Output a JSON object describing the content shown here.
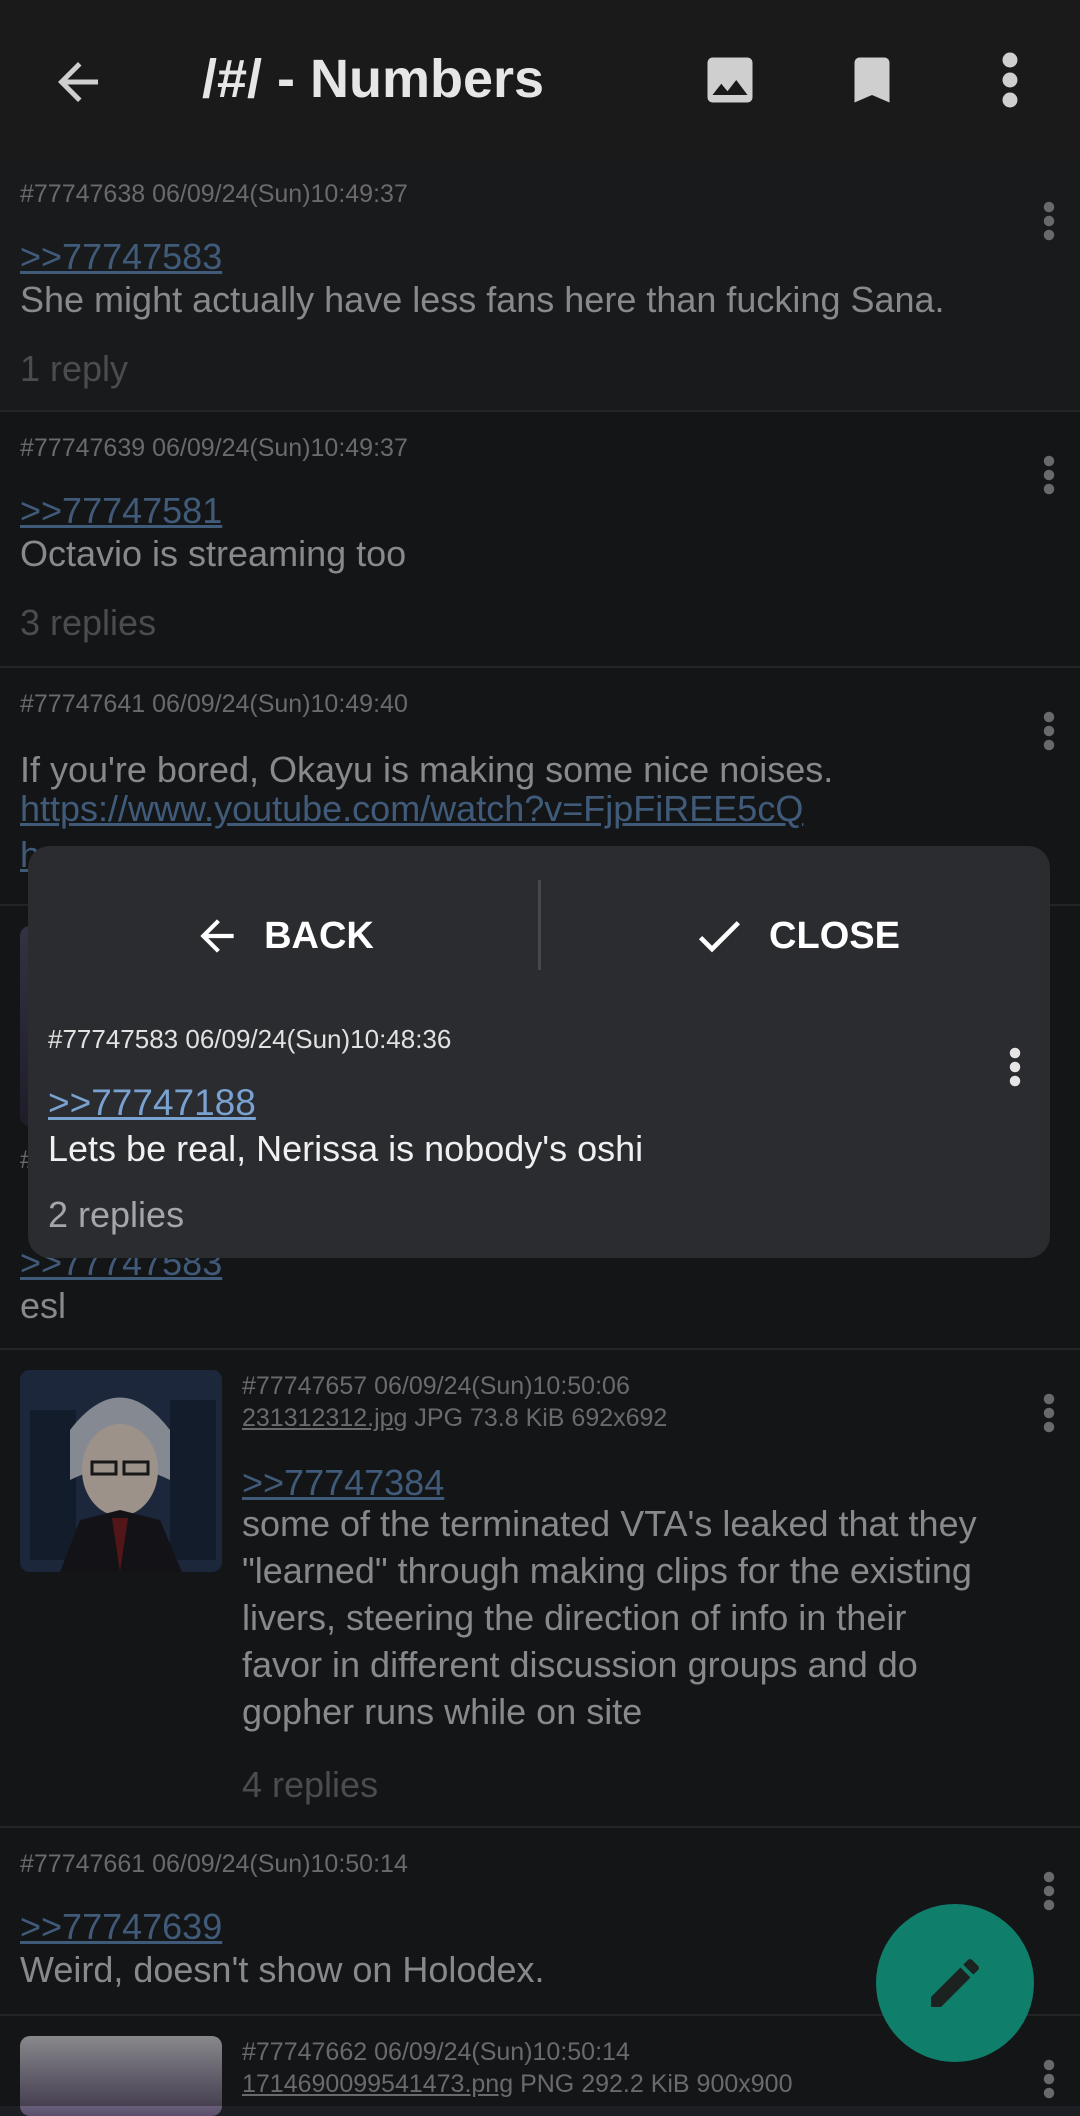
{
  "appbar": {
    "title": "/#/ - Numbers"
  },
  "posts": [
    {
      "meta": "#77747638 06/09/24(Sun)10:49:37",
      "quote": ">>77747583",
      "body": "She might actually have less fans here than fucking Sana.",
      "replies": "1 reply"
    },
    {
      "meta": "#77747639 06/09/24(Sun)10:49:37",
      "quote": ">>77747581",
      "body": "Octavio is streaming too",
      "replies": "3 replies"
    },
    {
      "meta": "#77747641 06/09/24(Sun)10:49:40",
      "body": "If you're bored, Okayu is making some nice noises.",
      "link": "https://www.youtube.com/watch?v=FjpFiREE5cQ",
      "link2": "h"
    },
    {
      "meta": "#",
      "quote": ">>77747583",
      "body": "esl"
    },
    {
      "meta": "#77747657 06/09/24(Sun)10:50:06",
      "file_name": "231312312.jpg",
      "file_info": " JPG 73.8 KiB 692x692",
      "quote": ">>77747384",
      "body_lines": [
        "some of the terminated VTA's leaked that they",
        "\"learned\" through making clips for the existing",
        "livers, steering the direction of info in their",
        "favor in different discussion groups and do",
        "gopher runs while on site"
      ],
      "replies": "4 replies"
    },
    {
      "meta": "#77747661 06/09/24(Sun)10:50:14",
      "quote": ">>77747639",
      "body": "Weird, doesn't show on Holodex."
    },
    {
      "meta": "#77747662 06/09/24(Sun)10:50:14",
      "file_name": "1714690099541473.png",
      "file_info": " PNG 292.2 KiB 900x900"
    }
  ],
  "popup": {
    "back_label": "BACK",
    "close_label": "CLOSE",
    "meta": "#77747583 06/09/24(Sun)10:48:36",
    "quote": ">>77747188",
    "body": "Lets be real, Nerissa is nobody's oshi",
    "replies": "2 replies"
  },
  "icons": {
    "back": "arrow-left-icon",
    "image": "image-icon",
    "bookmark": "bookmark-icon",
    "more": "more-vert-icon",
    "check": "check-icon",
    "edit": "pencil-icon"
  },
  "colors": {
    "background": "#1e1f22",
    "link": "#5f87b4",
    "fab": "#0f7f6b",
    "popup": "#2b2c30"
  }
}
